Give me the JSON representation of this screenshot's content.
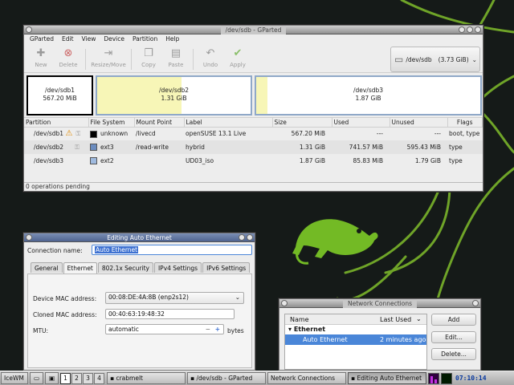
{
  "gparted": {
    "title": "/dev/sdb - GParted",
    "menu": [
      "GParted",
      "Edit",
      "View",
      "Device",
      "Partition",
      "Help"
    ],
    "toolbar": [
      {
        "label": "New",
        "icon": "new-icon",
        "glyph": "✚"
      },
      {
        "label": "Delete",
        "icon": "delete-icon",
        "glyph": "⊗"
      },
      {
        "label": "Resize/Move",
        "icon": "resize-icon",
        "glyph": "⇥"
      },
      {
        "label": "Copy",
        "icon": "copy-icon",
        "glyph": "❐"
      },
      {
        "label": "Paste",
        "icon": "paste-icon",
        "glyph": "▤"
      },
      {
        "label": "Undo",
        "icon": "undo-icon",
        "glyph": "↶"
      },
      {
        "label": "Apply",
        "icon": "apply-icon",
        "glyph": "✔"
      }
    ],
    "device": "/dev/sdb",
    "device_size": "(3.73 GiB)",
    "map": [
      {
        "name": "/dev/sdb1",
        "size": "567.20 MiB",
        "used_frac": 0.0
      },
      {
        "name": "/dev/sdb2",
        "size": "1.31 GiB",
        "used_frac": 0.55
      },
      {
        "name": "/dev/sdb3",
        "size": "1.87 GiB",
        "used_frac": 0.05
      }
    ],
    "columns": [
      "Partition",
      "File System",
      "Mount Point",
      "Label",
      "Size",
      "Used",
      "Unused",
      "Flags"
    ],
    "rows": [
      {
        "partition": "/dev/sdb1",
        "fs": "unknown",
        "fs_color": "#000000",
        "mount": "/livecd",
        "label": "openSUSE 13.1 Live",
        "size": "567.20 MiB",
        "used": "---",
        "unused": "---",
        "flags": "boot, type",
        "warn": true
      },
      {
        "partition": "/dev/sdb2",
        "fs": "ext3",
        "fs_color": "#6b8cbf",
        "mount": "/read-write",
        "label": "hybrid",
        "size": "1.31 GiB",
        "used": "741.57 MiB",
        "unused": "595.43 MiB",
        "flags": "type",
        "warn": false
      },
      {
        "partition": "/dev/sdb3",
        "fs": "ext2",
        "fs_color": "#9fbadf",
        "mount": "",
        "label": "UD03_iso",
        "size": "1.87 GiB",
        "used": "85.83 MiB",
        "unused": "1.79 GiB",
        "flags": "type",
        "warn": false
      }
    ],
    "status": "0 operations pending"
  },
  "editor": {
    "title": "Editing Auto Ethernet",
    "conn_label": "Connection name:",
    "conn_value": "Auto Ethernet",
    "tabs": [
      "General",
      "Ethernet",
      "802.1x Security",
      "IPv4 Settings",
      "IPv6 Settings"
    ],
    "active_tab": 1,
    "device_mac_label": "Device MAC address:",
    "device_mac": "00:08:DE:4A:8B (enp2s12)",
    "cloned_mac_label": "Cloned MAC address:",
    "cloned_mac": "00:40:63:19:48:32",
    "mtu_label": "MTU:",
    "mtu_value": "automatic",
    "mtu_unit": "bytes"
  },
  "netconn": {
    "title": "Network Connections",
    "col_name": "Name",
    "col_last": "Last Used",
    "group": "Ethernet",
    "conn_name": "Auto Ethernet",
    "conn_time": "2 minutes ago",
    "add": "Add",
    "edit": "Edit...",
    "delete": "Delete..."
  },
  "taskbar": {
    "start": "IceWM",
    "workspaces": [
      "1",
      "2",
      "3",
      "4"
    ],
    "items": [
      "crabmelt",
      "/dev/sdb - GParted",
      "Network Connections",
      "Editing Auto Ethernet"
    ],
    "clock": "07:10:14"
  },
  "colors": {
    "accent": "#3d71d1",
    "selection": "#4a86d8",
    "chameleon": "#73ba25",
    "sdb2_used": "#f7f6b7"
  }
}
